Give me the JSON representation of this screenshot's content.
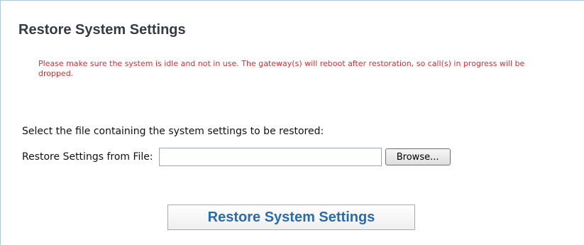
{
  "section": {
    "title": "Restore System Settings",
    "warning": "Please make sure the system is idle and not in use. The gateway(s) will reboot after restoration, so call(s) in progress will be dropped.",
    "select_instruction": "Select the file containing the system settings to be restored:"
  },
  "file_row": {
    "label": "Restore Settings from File:",
    "value": "",
    "browse_label": "Browse..."
  },
  "actions": {
    "restore_label": "Restore System Settings"
  },
  "colors": {
    "warning_text": "#e8252d",
    "restore_button_text": "#2a6bab",
    "panel_border": "#aac8de"
  }
}
